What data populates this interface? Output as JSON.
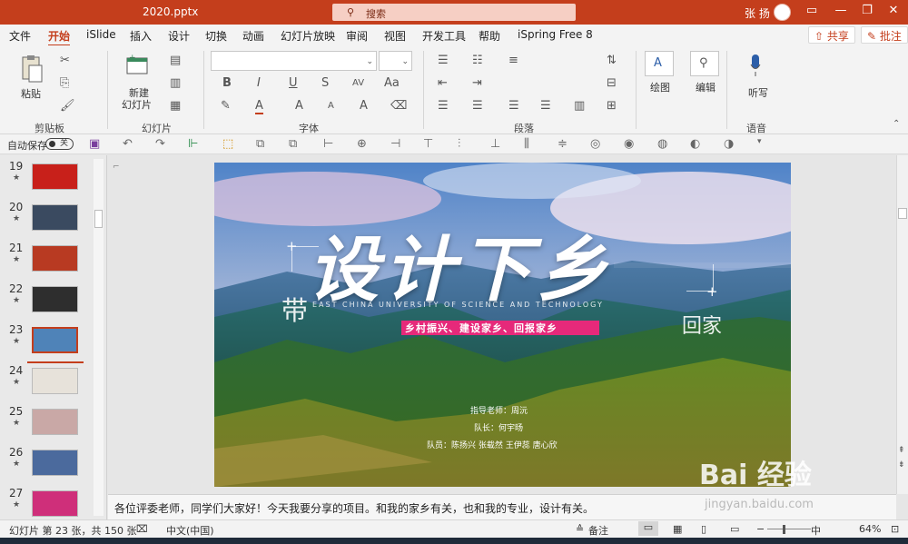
{
  "title_bar": {
    "filename": "2020.pptx",
    "search_placeholder": "搜索",
    "user_name": "张 扬",
    "minimize": "—",
    "restore": "❐",
    "close": "✕",
    "ribbon_opts": "▭"
  },
  "menu": {
    "tabs": [
      "文件",
      "开始",
      "iSlide",
      "插入",
      "设计",
      "切换",
      "动画",
      "幻灯片放映",
      "审阅",
      "视图",
      "开发工具",
      "帮助",
      "iSpring Free 8"
    ],
    "active_tab": "开始",
    "share": "共享",
    "comment": "批注"
  },
  "ribbon": {
    "paste": "粘贴",
    "new_slide_line1": "新建",
    "new_slide_line2": "幻灯片",
    "groups": {
      "clipboard": "剪贴板",
      "slides": "幻灯片",
      "font": "字体",
      "paragraph": "段落",
      "voice": "语音"
    },
    "font_buttons": [
      "B",
      "I",
      "U",
      "S",
      "AV",
      "A",
      "A",
      "A",
      "Aa",
      "A"
    ],
    "draw": "绘图",
    "edit": "编辑",
    "dictate": "听写"
  },
  "qat": {
    "autosave_label": "自动保存",
    "autosave_state": "关"
  },
  "thumbnails": [
    {
      "num": "19",
      "color": "#c8201a"
    },
    {
      "num": "20",
      "color": "#3a4a60"
    },
    {
      "num": "21",
      "color": "#b83a22"
    },
    {
      "num": "22",
      "color": "#2e2e2e"
    },
    {
      "num": "23",
      "color": "#4f83b8"
    },
    {
      "num": "24",
      "color": "#e7e2da"
    },
    {
      "num": "25",
      "color": "#c9a8a6"
    },
    {
      "num": "26",
      "color": "#4b6a9d"
    },
    {
      "num": "27",
      "color": "#cf2f7a"
    }
  ],
  "slide": {
    "title_calligraphy": "设计下乡",
    "subtitle_en": "EAST CHINA UNIVERSITY OF SCIENCE AND TECHNOLOGY",
    "left_char": "带",
    "right_chars": "回家",
    "slogan": "乡村振兴、建设家乡、回报家乡",
    "advisor": "指导老师：周沅",
    "leader": "队长：何宇旸",
    "members": "队员：陈扬兴  张载然  王伊蕊  唐心欣"
  },
  "notes_text": "各位评委老师，同学们大家好！今天我要分享的项目。和我的家乡有关，也和我的专业，设计有关。",
  "status": {
    "slide_info": "幻灯片 第 23 张，共 150 张",
    "language": "中文(中国)",
    "notes_btn": "备注",
    "zoom": "64%",
    "ime": "中"
  },
  "watermark": {
    "brand": "Bai 经验",
    "url": "jingyan.baidu.com"
  }
}
